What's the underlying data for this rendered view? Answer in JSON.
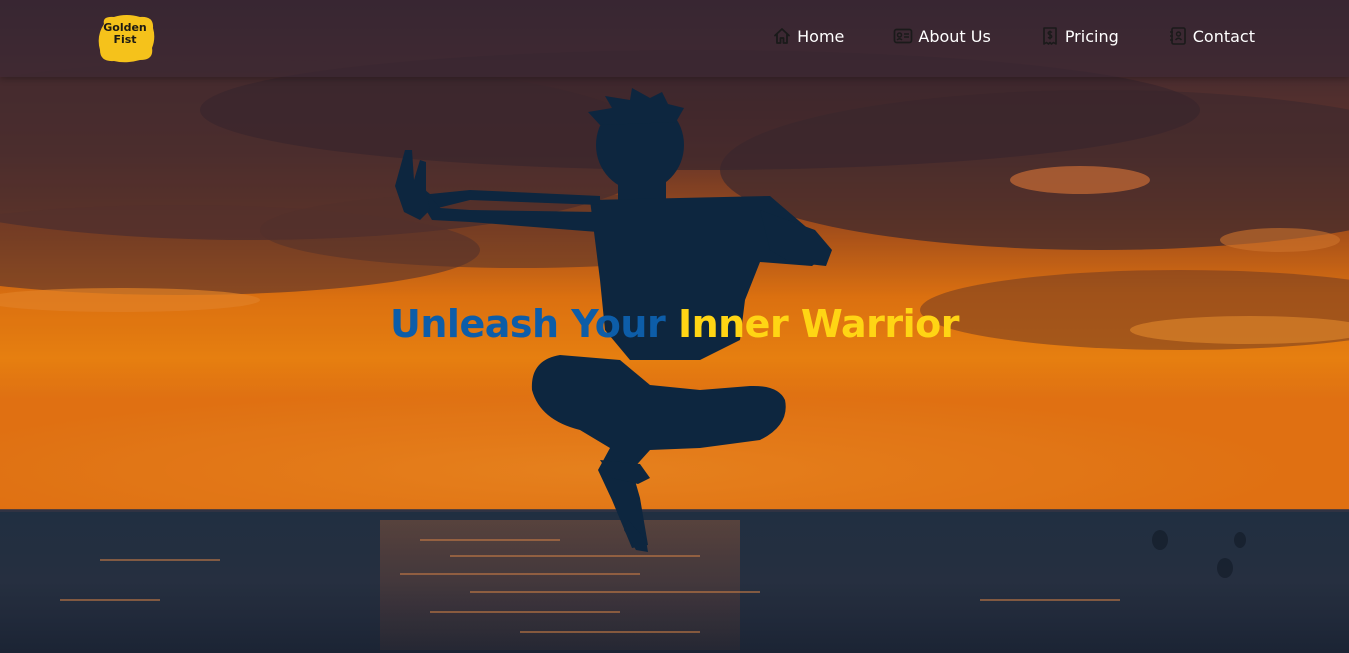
{
  "navbar": {
    "logo": {
      "line1": "Golden",
      "line2": "Fist",
      "color": "#f5c21b"
    },
    "items": [
      {
        "label": "Home",
        "icon": "home-icon"
      },
      {
        "label": "About Us",
        "icon": "id-card-icon"
      },
      {
        "label": "Pricing",
        "icon": "receipt-dollar-icon"
      },
      {
        "label": "Contact",
        "icon": "address-book-icon"
      }
    ]
  },
  "hero": {
    "title_part1": "Unleash Your",
    "title_part2": "Inner Warrior",
    "title_color1": "#0d5da8",
    "title_color2": "#ffd514",
    "image": "silhouette of a person jumping in a martial-arts pose over the sea at sunset"
  }
}
